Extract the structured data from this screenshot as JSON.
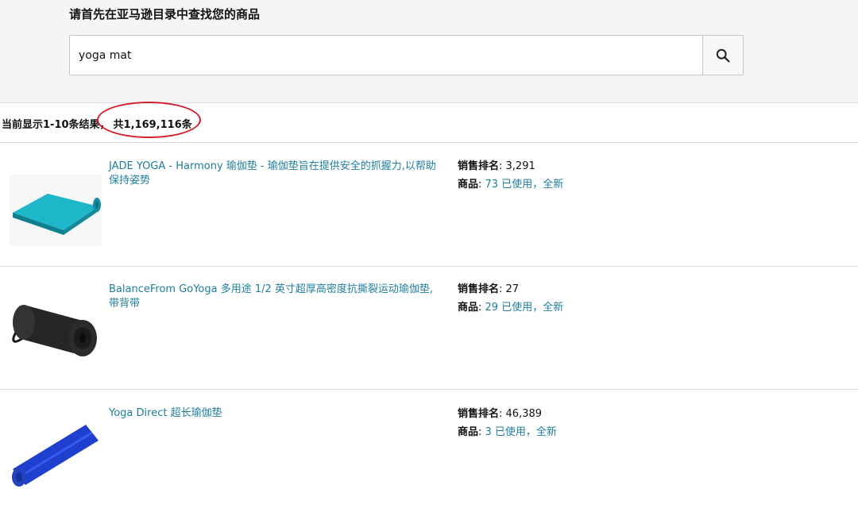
{
  "header": {
    "prompt": "请首先在亚马逊目录中查找您的商品",
    "search_value": "yoga mat",
    "search_icon": "search-icon"
  },
  "results": {
    "showing": "当前显示1-10条结果，",
    "total": "共1,169,116条",
    "highlight_color": "#d2202c"
  },
  "items": [
    {
      "title": "JADE YOGA - Harmony 瑜伽垫 - 瑜伽垫旨在提供安全的抓握力,以帮助保持姿势",
      "rank_label": "销售排名",
      "rank_value": "3,291",
      "offers_label": "商品",
      "offers_value": "73 已使用，全新",
      "image": "teal-yoga-mat"
    },
    {
      "title": "BalanceFrom GoYoga 多用途 1/2 英寸超厚高密度抗撕裂运动瑜伽垫,带背带",
      "rank_label": "销售排名",
      "rank_value": "27",
      "offers_label": "商品",
      "offers_value": "29 已使用，全新",
      "image": "black-yoga-mat"
    },
    {
      "title": "Yoga Direct 超长瑜伽垫",
      "rank_label": "销售排名",
      "rank_value": "46,389",
      "offers_label": "商品",
      "offers_value": "3 已使用，全新",
      "image": "blue-yoga-mat"
    }
  ],
  "colors": {
    "link": "#1f7d9b",
    "panel_bg": "#f3f5f6"
  }
}
